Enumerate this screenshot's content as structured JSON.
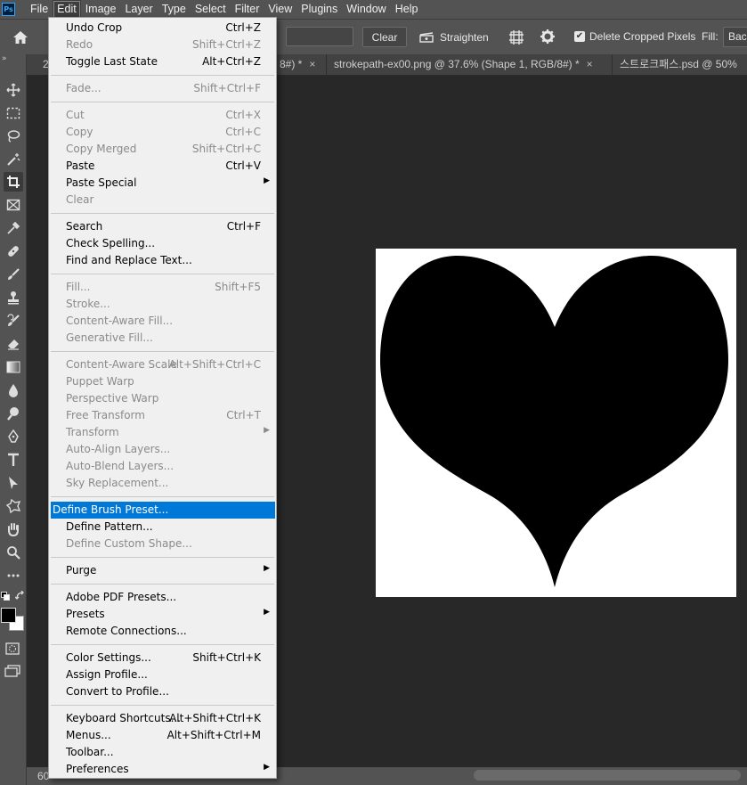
{
  "app": {
    "logo": "Ps"
  },
  "menubar": {
    "items": [
      {
        "label": "File"
      },
      {
        "label": "Edit"
      },
      {
        "label": "Image"
      },
      {
        "label": "Layer"
      },
      {
        "label": "Type"
      },
      {
        "label": "Select"
      },
      {
        "label": "Filter"
      },
      {
        "label": "View"
      },
      {
        "label": "Plugins"
      },
      {
        "label": "Window"
      },
      {
        "label": "Help"
      }
    ],
    "active": "Edit"
  },
  "options_bar": {
    "clear_label": "Clear",
    "straighten_label": "Straighten",
    "delete_cropped_label": "Delete Cropped Pixels",
    "delete_cropped_checked": true,
    "fill_label": "Fill:",
    "fill_value": "Background"
  },
  "tabs": [
    {
      "label": "2"
    },
    {
      "label": "8#) *",
      "close": "×"
    },
    {
      "label": "strokepath-ex00.png @ 37.6% (Shape 1, RGB/8#) *",
      "close": "×"
    },
    {
      "label": "스트로크패스.psd @ 50%"
    }
  ],
  "status": {
    "zoom": "60"
  },
  "tools": [
    "move-tool-icon",
    "marquee-tool-icon",
    "lasso-tool-icon",
    "magic-wand-tool-icon",
    "crop-tool-icon",
    "frame-tool-icon",
    "eyedropper-tool-icon",
    "healing-brush-tool-icon",
    "brush-tool-icon",
    "stamp-tool-icon",
    "history-brush-tool-icon",
    "eraser-tool-icon",
    "gradient-tool-icon",
    "blur-tool-icon",
    "dodge-tool-icon",
    "pen-tool-icon",
    "type-tool-icon",
    "path-selection-tool-icon",
    "shape-tool-icon",
    "hand-tool-icon",
    "zoom-tool-icon",
    "more-tools-icon"
  ],
  "colors": {
    "foreground": "#000000",
    "background": "#ffffff",
    "menu_highlight": "#0078d7"
  },
  "edit_menu": {
    "groups": [
      [
        {
          "label": "Undo Crop",
          "shortcut": "Ctrl+Z",
          "enabled": true
        },
        {
          "label": "Redo",
          "shortcut": "Shift+Ctrl+Z",
          "enabled": false
        },
        {
          "label": "Toggle Last State",
          "shortcut": "Alt+Ctrl+Z",
          "enabled": true
        }
      ],
      [
        {
          "label": "Fade...",
          "shortcut": "Shift+Ctrl+F",
          "enabled": false
        }
      ],
      [
        {
          "label": "Cut",
          "shortcut": "Ctrl+X",
          "enabled": false
        },
        {
          "label": "Copy",
          "shortcut": "Ctrl+C",
          "enabled": false
        },
        {
          "label": "Copy Merged",
          "shortcut": "Shift+Ctrl+C",
          "enabled": false
        },
        {
          "label": "Paste",
          "shortcut": "Ctrl+V",
          "enabled": true
        },
        {
          "label": "Paste Special",
          "shortcut": "",
          "enabled": true,
          "submenu": true
        },
        {
          "label": "Clear",
          "shortcut": "",
          "enabled": false
        }
      ],
      [
        {
          "label": "Search",
          "shortcut": "Ctrl+F",
          "enabled": true
        },
        {
          "label": "Check Spelling...",
          "shortcut": "",
          "enabled": true
        },
        {
          "label": "Find and Replace Text...",
          "shortcut": "",
          "enabled": true
        }
      ],
      [
        {
          "label": "Fill...",
          "shortcut": "Shift+F5",
          "enabled": false
        },
        {
          "label": "Stroke...",
          "shortcut": "",
          "enabled": false
        },
        {
          "label": "Content-Aware Fill...",
          "shortcut": "",
          "enabled": false
        },
        {
          "label": "Generative Fill...",
          "shortcut": "",
          "enabled": false
        }
      ],
      [
        {
          "label": "Content-Aware Scale",
          "shortcut": "Alt+Shift+Ctrl+C",
          "enabled": false
        },
        {
          "label": "Puppet Warp",
          "shortcut": "",
          "enabled": false
        },
        {
          "label": "Perspective Warp",
          "shortcut": "",
          "enabled": false
        },
        {
          "label": "Free Transform",
          "shortcut": "Ctrl+T",
          "enabled": false
        },
        {
          "label": "Transform",
          "shortcut": "",
          "enabled": false,
          "submenu": true
        },
        {
          "label": "Auto-Align Layers...",
          "shortcut": "",
          "enabled": false
        },
        {
          "label": "Auto-Blend Layers...",
          "shortcut": "",
          "enabled": false
        },
        {
          "label": "Sky Replacement...",
          "shortcut": "",
          "enabled": false
        }
      ],
      [
        {
          "label": "Define Brush Preset...",
          "shortcut": "",
          "enabled": true,
          "highlighted": true
        },
        {
          "label": "Define Pattern...",
          "shortcut": "",
          "enabled": true
        },
        {
          "label": "Define Custom Shape...",
          "shortcut": "",
          "enabled": false
        }
      ],
      [
        {
          "label": "Purge",
          "shortcut": "",
          "enabled": true,
          "submenu": true
        }
      ],
      [
        {
          "label": "Adobe PDF Presets...",
          "shortcut": "",
          "enabled": true
        },
        {
          "label": "Presets",
          "shortcut": "",
          "enabled": true,
          "submenu": true
        },
        {
          "label": "Remote Connections...",
          "shortcut": "",
          "enabled": true
        }
      ],
      [
        {
          "label": "Color Settings...",
          "shortcut": "Shift+Ctrl+K",
          "enabled": true
        },
        {
          "label": "Assign Profile...",
          "shortcut": "",
          "enabled": true
        },
        {
          "label": "Convert to Profile...",
          "shortcut": "",
          "enabled": true
        }
      ],
      [
        {
          "label": "Keyboard Shortcuts...",
          "shortcut": "Alt+Shift+Ctrl+K",
          "enabled": true
        },
        {
          "label": "Menus...",
          "shortcut": "Alt+Shift+Ctrl+M",
          "enabled": true
        },
        {
          "label": "Toolbar...",
          "shortcut": "",
          "enabled": true
        },
        {
          "label": "Preferences",
          "shortcut": "",
          "enabled": true,
          "submenu": true
        }
      ]
    ]
  }
}
